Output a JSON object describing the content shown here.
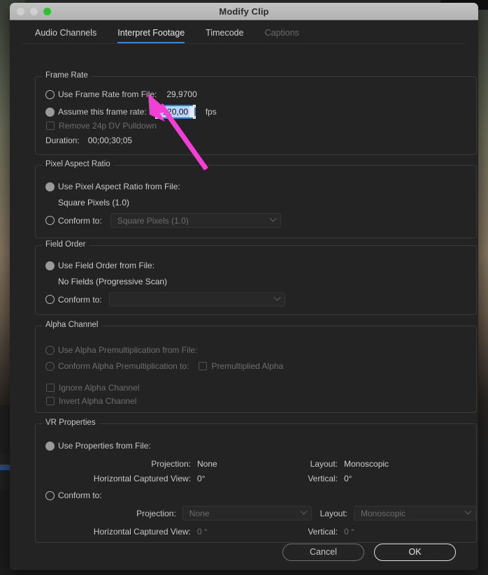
{
  "window": {
    "title": "Modify Clip",
    "traffic_lights": [
      "close-light",
      "minimize-light",
      "zoom-light"
    ]
  },
  "tabs": [
    {
      "label": "Audio Channels",
      "state": "inactive"
    },
    {
      "label": "Interpret Footage",
      "state": "active"
    },
    {
      "label": "Timecode",
      "state": "inactive"
    },
    {
      "label": "Captions",
      "state": "disabled"
    }
  ],
  "frame_rate": {
    "legend": "Frame Rate",
    "use_from_file_label": "Use Frame Rate from File:",
    "use_from_file_value": "29,9700",
    "use_from_file_selected": false,
    "assume_label": "Assume this frame rate:",
    "assume_selected": true,
    "assume_value": "120,00",
    "fps_unit": "fps",
    "remove_pulldown_label": "Remove 24p DV Pulldown",
    "remove_pulldown_checked": false,
    "remove_pulldown_disabled": true,
    "duration_label": "Duration:",
    "duration_value": "00;00;30;05"
  },
  "pixel_aspect_ratio": {
    "legend": "Pixel Aspect Ratio",
    "use_from_file_label": "Use Pixel Aspect Ratio from File:",
    "use_from_file_selected": true,
    "use_from_file_value": "Square Pixels (1.0)",
    "conform_label": "Conform to:",
    "conform_selected": false,
    "conform_value": "Square Pixels (1.0)"
  },
  "field_order": {
    "legend": "Field Order",
    "use_from_file_label": "Use Field Order from File:",
    "use_from_file_selected": true,
    "use_from_file_value": "No Fields (Progressive Scan)",
    "conform_label": "Conform to:",
    "conform_selected": false,
    "conform_value": ""
  },
  "alpha_channel": {
    "legend": "Alpha Channel",
    "use_premultiplication_label": "Use Alpha Premultiplication from File:",
    "conform_premultiplication_label": "Conform Alpha Premultiplication to:",
    "premultiplied_alpha_label": "Premultiplied Alpha",
    "ignore_alpha_label": "Ignore Alpha Channel",
    "invert_alpha_label": "Invert Alpha Channel",
    "disabled": true
  },
  "vr_properties": {
    "legend": "VR Properties",
    "use_from_file_label": "Use Properties from File:",
    "use_from_file_selected": true,
    "file_projection_label": "Projection:",
    "file_projection_value": "None",
    "file_layout_label": "Layout:",
    "file_layout_value": "Monoscopic",
    "file_horizontal_label": "Horizontal Captured View:",
    "file_horizontal_value": "0°",
    "file_vertical_label": "Vertical:",
    "file_vertical_value": "0°",
    "conform_label": "Conform to:",
    "conform_selected": false,
    "conform_projection_label": "Projection:",
    "conform_projection_value": "None",
    "conform_layout_label": "Layout:",
    "conform_layout_value": "Monoscopic",
    "conform_horizontal_label": "Horizontal Captured View:",
    "conform_horizontal_value": "0 °",
    "conform_vertical_label": "Vertical:",
    "conform_vertical_value": "0 °"
  },
  "footer": {
    "cancel_label": "Cancel",
    "ok_label": "OK"
  },
  "annotation": {
    "arrow_color": "#f23fd4",
    "target": "assume-frame-rate-input"
  }
}
